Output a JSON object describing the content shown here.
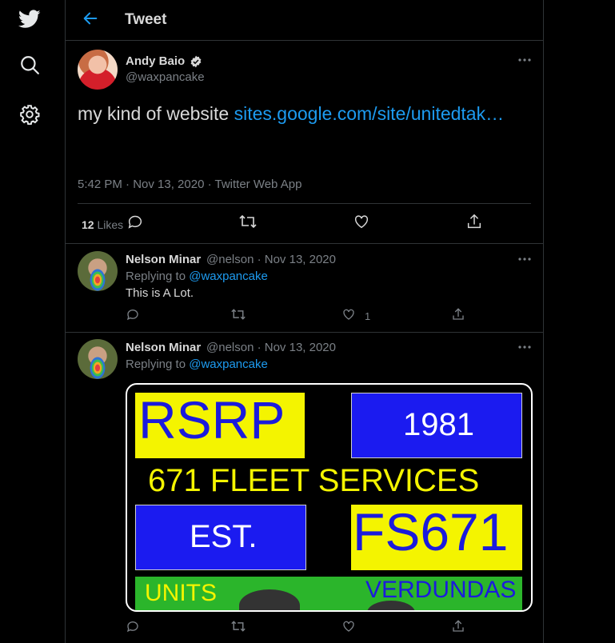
{
  "nav": {
    "items": [
      "twitter-logo",
      "search-icon",
      "settings-icon"
    ]
  },
  "header": {
    "title": "Tweet"
  },
  "tweet": {
    "author_name": "Andy Baio",
    "author_handle": "@waxpancake",
    "text_prefix": "my kind of website ",
    "link_text": "sites.google.com/site/unitedtak…",
    "meta": "5:42 PM · Nov 13, 2020 · Twitter Web App",
    "likes_count": "12",
    "likes_label": " Likes"
  },
  "replies": [
    {
      "author_name": "Nelson Minar",
      "author_handle": "@nelson · Nov 13, 2020",
      "replying_prefix": "Replying to ",
      "replying_handle": "@waxpancake",
      "text": "This is A Lot.",
      "like_count": "1"
    },
    {
      "author_name": "Nelson Minar",
      "author_handle": "@nelson · Nov 13, 2020",
      "replying_prefix": "Replying to ",
      "replying_handle": "@waxpancake",
      "image": {
        "rsrp": "RSRP",
        "year": "1981",
        "fleet": "671 FLEET SERVICES",
        "est": "EST.",
        "fs": "FS671",
        "units": "UNITS",
        "verdundas": "VERDUNDAS"
      }
    }
  ],
  "colors": {
    "accent": "#1d9bf0",
    "background": "#000000",
    "border": "#2f3336",
    "muted": "#7b8086"
  }
}
